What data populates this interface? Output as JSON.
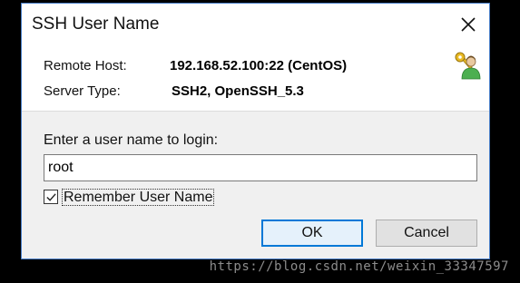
{
  "window": {
    "title": "SSH User Name"
  },
  "info": {
    "remote_host_label": "Remote Host:",
    "remote_host_value": "192.168.52.100:22 (CentOS)",
    "server_type_label": "Server Type:",
    "server_type_value": "SSH2, OpenSSH_5.3",
    "icon": "user-key-icon"
  },
  "form": {
    "prompt": "Enter a user name to login:",
    "username_value": "root",
    "remember_label": "Remember User Name",
    "remember_checked": true
  },
  "buttons": {
    "ok": "OK",
    "cancel": "Cancel"
  },
  "watermark": "https://blog.csdn.net/weixin_33347597",
  "colors": {
    "accent": "#0078d7",
    "dialog_bg": "#f0f0f0",
    "backdrop": "#000000"
  }
}
